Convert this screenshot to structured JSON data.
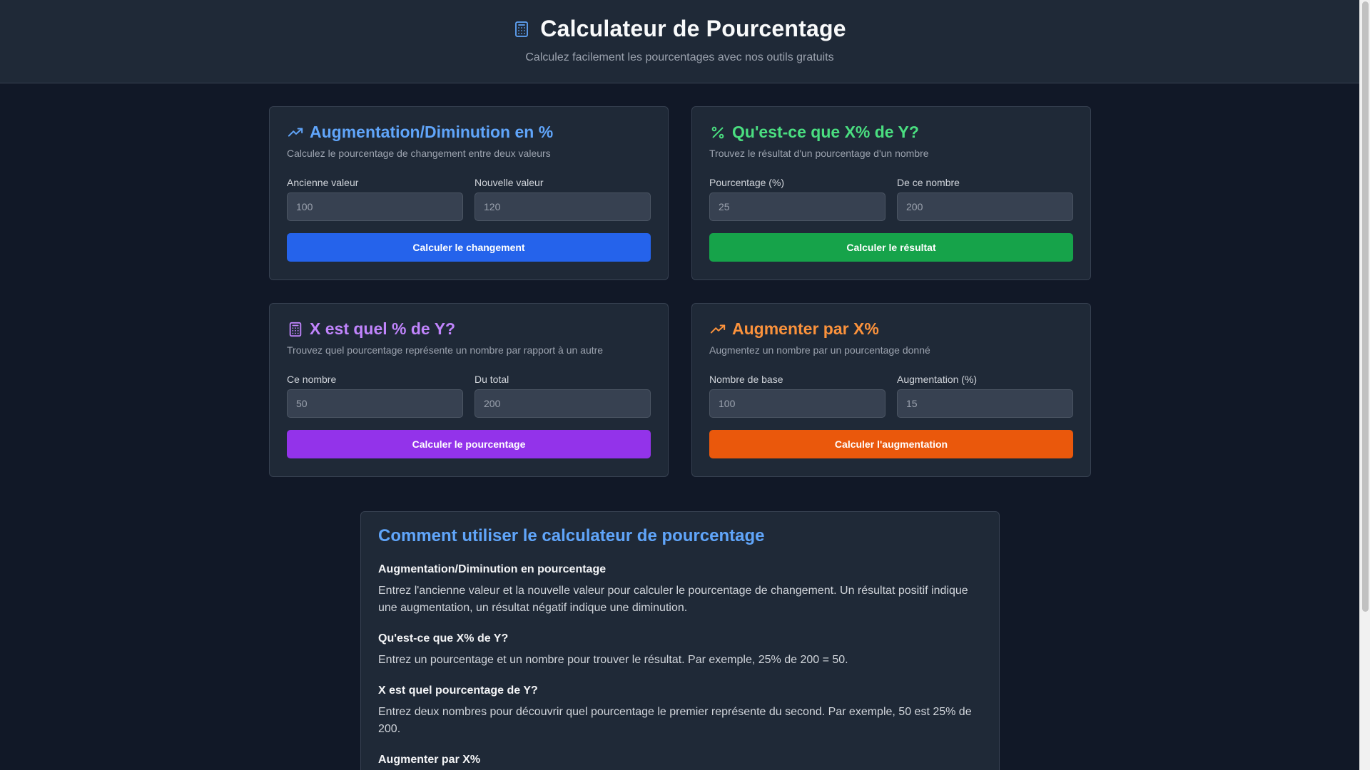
{
  "header": {
    "title": "Calculateur de Pourcentage",
    "subtitle": "Calculez facilement les pourcentages avec nos outils gratuits",
    "icon": "calculator-icon"
  },
  "cards": [
    {
      "title": "Augmentation/Diminution en %",
      "description": "Calculez le pourcentage de changement entre deux valeurs",
      "icon": "trending-up-icon",
      "color": "#60a5fa",
      "field1": {
        "label": "Ancienne valeur",
        "placeholder": "100"
      },
      "field2": {
        "label": "Nouvelle valeur",
        "placeholder": "120"
      },
      "button": "Calculer le changement",
      "button_color": "#2563eb"
    },
    {
      "title": "Qu'est-ce que X% de Y?",
      "description": "Trouvez le résultat d'un pourcentage d'un nombre",
      "icon": "percent-icon",
      "color": "#4ade80",
      "field1": {
        "label": "Pourcentage (%)",
        "placeholder": "25"
      },
      "field2": {
        "label": "De ce nombre",
        "placeholder": "200"
      },
      "button": "Calculer le résultat",
      "button_color": "#16a34a"
    },
    {
      "title": "X est quel % de Y?",
      "description": "Trouvez quel pourcentage représente un nombre par rapport à un autre",
      "icon": "calculator-icon",
      "color": "#c084fc",
      "field1": {
        "label": "Ce nombre",
        "placeholder": "50"
      },
      "field2": {
        "label": "Du total",
        "placeholder": "200"
      },
      "button": "Calculer le pourcentage",
      "button_color": "#9333ea"
    },
    {
      "title": "Augmenter par X%",
      "description": "Augmentez un nombre par un pourcentage donné",
      "icon": "trending-up-icon",
      "color": "#fb923c",
      "field1": {
        "label": "Nombre de base",
        "placeholder": "100"
      },
      "field2": {
        "label": "Augmentation (%)",
        "placeholder": "15"
      },
      "button": "Calculer l'augmentation",
      "button_color": "#ea580c"
    }
  ],
  "guide": {
    "title": "Comment utiliser le calculateur de pourcentage",
    "sections": [
      {
        "heading": "Augmentation/Diminution en pourcentage",
        "text": "Entrez l'ancienne valeur et la nouvelle valeur pour calculer le pourcentage de changement. Un résultat positif indique une augmentation, un résultat négatif indique une diminution."
      },
      {
        "heading": "Qu'est-ce que X% de Y?",
        "text": "Entrez un pourcentage et un nombre pour trouver le résultat. Par exemple, 25% de 200 = 50."
      },
      {
        "heading": "X est quel pourcentage de Y?",
        "text": "Entrez deux nombres pour découvrir quel pourcentage le premier représente du second. Par exemple, 50 est 25% de 200."
      },
      {
        "heading": "Augmenter par X%",
        "text": ""
      }
    ]
  }
}
